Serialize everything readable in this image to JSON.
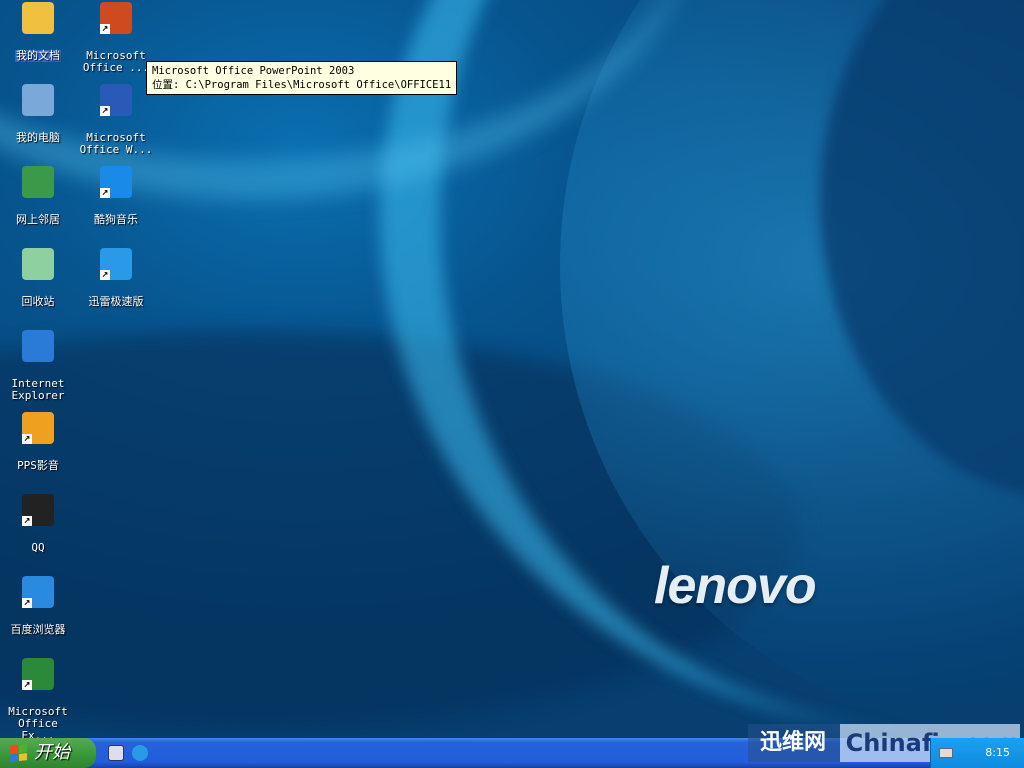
{
  "desktop_icons": [
    {
      "label": "我的文档",
      "icon": "my-documents-icon",
      "color": "#f0c040",
      "shortcut": false,
      "selected": true
    },
    {
      "label": "我的电脑",
      "icon": "my-computer-icon",
      "color": "#7aa8d8",
      "shortcut": false
    },
    {
      "label": "网上邻居",
      "icon": "network-places-icon",
      "color": "#3a9a4a",
      "shortcut": false
    },
    {
      "label": "回收站",
      "icon": "recycle-bin-icon",
      "color": "#8fd0a0",
      "shortcut": false
    },
    {
      "label": "Internet Explorer",
      "icon": "internet-explorer-icon",
      "color": "#2a7ad8",
      "shortcut": false
    },
    {
      "label": "PPS影音",
      "icon": "pps-icon",
      "color": "#f0a020",
      "shortcut": true
    },
    {
      "label": "QQ",
      "icon": "qq-icon",
      "color": "#222222",
      "shortcut": true
    },
    {
      "label": "百度浏览器",
      "icon": "baidu-browser-icon",
      "color": "#2a8ae0",
      "shortcut": true
    },
    {
      "label": "Microsoft Office Ex...",
      "icon": "excel-icon",
      "color": "#2a8a3a",
      "shortcut": true
    }
  ],
  "desktop_icons_col2": [
    {
      "label": "Microsoft Office ...",
      "icon": "powerpoint-icon",
      "color": "#d04a20",
      "shortcut": true
    },
    {
      "label": "Microsoft Office W...",
      "icon": "word-icon",
      "color": "#2a5ab8",
      "shortcut": true
    },
    {
      "label": "酷狗音乐",
      "icon": "kugou-icon",
      "color": "#1a8ae8",
      "shortcut": true
    },
    {
      "label": "迅雷极速版",
      "icon": "thunder-icon",
      "color": "#2a9ae8",
      "shortcut": true
    }
  ],
  "tooltip": {
    "line1": "Microsoft Office PowerPoint 2003",
    "line2": "位置: C:\\Program Files\\Microsoft Office\\OFFICE11"
  },
  "wallpaper": {
    "brand": "lenovo"
  },
  "taskbar": {
    "start_label": "开始",
    "clock": "8:15"
  },
  "watermark": {
    "left": "迅维网",
    "right": "Chinafix.com"
  }
}
